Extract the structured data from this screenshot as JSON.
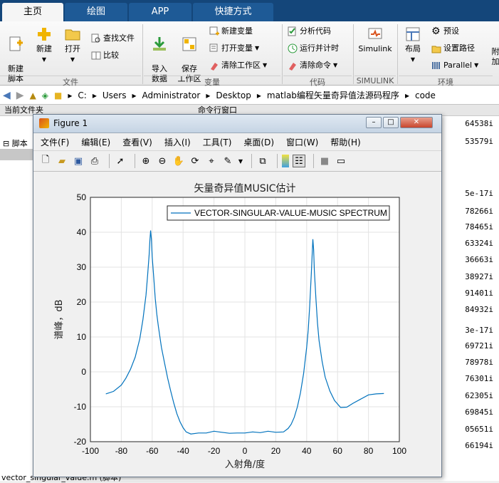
{
  "tabs": [
    "主页",
    "绘图",
    "APP",
    "快捷方式"
  ],
  "ribbon": {
    "file": {
      "new_script": "新建\n脚本",
      "new": "新建",
      "open": "打开",
      "find_files": "查找文件",
      "compare": "比较",
      "group": "文件"
    },
    "variable": {
      "import": "导入\n数据",
      "save_ws": "保存\n工作区",
      "new_var": "新建变量",
      "open_var": "打开变量",
      "clear_ws": "清除工作区",
      "group": "变量"
    },
    "code": {
      "analyze": "分析代码",
      "run_time": "运行并计时",
      "clear_cmd": "清除命令",
      "group": "代码"
    },
    "simulink": {
      "label": "Simulink",
      "group": "SIMULINK"
    },
    "env": {
      "layout": "布局",
      "prefs": "预设",
      "set_path": "设置路径",
      "parallel": "Parallel",
      "addons": "附加",
      "group": "环境"
    }
  },
  "path": [
    "C:",
    "Users",
    "Administrator",
    "Desktop",
    "matlab编程矢量奇异值法源码程序",
    "code"
  ],
  "left_panel": {
    "title": "当前文件夹",
    "scripts_label": "脚本",
    "footer": "vector_singular_value.m (脚本)"
  },
  "right_panel": {
    "title": "命令行窗口"
  },
  "cmd_values": [
    "64538i",
    "53579i",
    "5e-17i",
    "78266i",
    "78465i",
    "63324i",
    "36663i",
    "38927i",
    "91401i",
    "84932i",
    "3e-17i",
    "69721i",
    "78978i",
    "76301i",
    "62305i",
    "69845i",
    "05651i",
    "66194i"
  ],
  "figure": {
    "title": "Figure 1",
    "menu": [
      "文件(F)",
      "编辑(E)",
      "查看(V)",
      "插入(I)",
      "工具(T)",
      "桌面(D)",
      "窗口(W)",
      "帮助(H)"
    ]
  },
  "chart_data": {
    "type": "line",
    "title": "矢量奇异值MUSIC估计",
    "xlabel": "入射角/度",
    "ylabel": "谱峰，dB",
    "xlim": [
      -100,
      100
    ],
    "ylim": [
      -20,
      50
    ],
    "xticks": [
      -100,
      -80,
      -60,
      -40,
      -20,
      0,
      20,
      40,
      60,
      80,
      100
    ],
    "yticks": [
      -20,
      -10,
      0,
      10,
      20,
      30,
      40,
      50
    ],
    "grid": true,
    "legend_position": "top-right",
    "color": "#0072bd",
    "series": [
      {
        "name": "VECTOR-SINGULAR-VALUE-MUSIC SPECTRUM",
        "x": [
          -90,
          -85,
          -80,
          -77,
          -74,
          -71,
          -68,
          -66,
          -64,
          -63,
          -62,
          -61.5,
          -61,
          -60.5,
          -60,
          -59,
          -58,
          -57,
          -56,
          -54,
          -52,
          -50,
          -48,
          -46,
          -44,
          -42,
          -40,
          -38,
          -35,
          -30,
          -25,
          -20,
          -15,
          -10,
          -5,
          0,
          5,
          10,
          15,
          20,
          25,
          28,
          30,
          32,
          34,
          36,
          38,
          40,
          41,
          42,
          43,
          43.5,
          44,
          44.5,
          45,
          46,
          47,
          48,
          50,
          52,
          55,
          58,
          62,
          66,
          70,
          75,
          80,
          85,
          90
        ],
        "y": [
          -6.3,
          -5.6,
          -3.8,
          -1.8,
          0.8,
          4.2,
          9.5,
          15,
          22,
          27.5,
          33.5,
          37.5,
          40.5,
          38,
          33,
          27,
          21,
          16.5,
          13,
          7,
          2.5,
          -1.8,
          -5.5,
          -9,
          -12,
          -14.3,
          -16,
          -17.2,
          -17.8,
          -17.5,
          -17.5,
          -17,
          -17.3,
          -17.6,
          -17.5,
          -17.5,
          -17.2,
          -17.4,
          -17,
          -17.3,
          -17.2,
          -16.2,
          -15,
          -13,
          -10,
          -6,
          -0.5,
          7,
          12,
          19,
          28,
          33,
          38,
          35,
          29,
          21,
          14,
          9,
          3,
          -1.5,
          -5.5,
          -8.2,
          -10.2,
          -10.1,
          -9,
          -7.8,
          -6.6,
          -6.3,
          -6.2
        ]
      }
    ]
  }
}
